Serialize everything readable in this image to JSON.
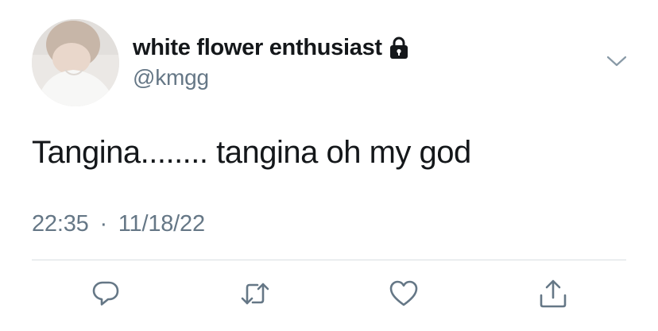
{
  "user": {
    "display_name": "white flower enthusiast",
    "handle": "@kmgg",
    "avatar_icon": "profile-photo",
    "protected_icon": "lock-icon"
  },
  "tweet": {
    "text": "Tangina........ tangina oh my god",
    "time": "22:35",
    "separator": "·",
    "date": "11/18/22"
  },
  "icons": {
    "menu": "chevron-down-icon",
    "reply": "reply-icon",
    "retweet": "retweet-icon",
    "like": "heart-icon",
    "share": "share-icon"
  },
  "colors": {
    "text": "#14171a",
    "secondary": "#657786",
    "icon": "#657786",
    "divider": "#d9dee2"
  }
}
